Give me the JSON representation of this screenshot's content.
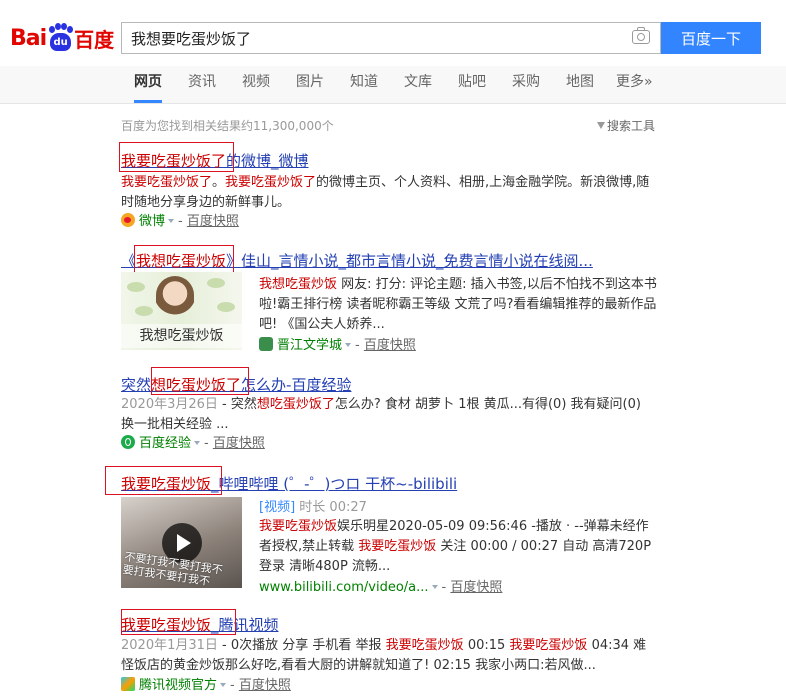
{
  "logo": {
    "bai": "Bai",
    "du": "du",
    "cn": "百度"
  },
  "search": {
    "query": "我想要吃蛋炒饭了",
    "button": "百度一下"
  },
  "tabs": [
    "网页",
    "资讯",
    "视频",
    "图片",
    "知道",
    "文库",
    "贴吧",
    "采购",
    "地图",
    "更多»"
  ],
  "active_tab": "网页",
  "result_count": "百度为您找到相关结果约11,300,000个",
  "search_tools": "搜索工具",
  "results": [
    {
      "title_hl": "我要吃蛋炒饭了",
      "title_rest": "的微博_微博",
      "desc_hl1": "我要吃蛋炒饭了",
      "desc_mid1": "。",
      "desc_hl2": "我要吃蛋炒饭了",
      "desc_rest": "的微博主页、个人资料、相册,上海金融学院。新浪微博,随时随地分享身边的新鲜事儿。",
      "source": "微博",
      "snapshot": "百度快照"
    },
    {
      "title_pre": "《",
      "title_hl": "我想吃蛋炒饭",
      "title_rest": "》佳山_言情小说_都市言情小说_免费言情小说在线阅...",
      "thumb_caption": "我想吃蛋炒饭",
      "desc_hl": "我想吃蛋炒饭",
      "desc_rest": " 网友: 打分: 评论主题: 插入书签,以后不怕找不到这本书啦!霸王排行榜 读者昵称霸王等级 文荒了吗?看看编辑推荐的最新作品吧! 《国公夫人娇养...",
      "source": "晋江文学城",
      "snapshot": "百度快照"
    },
    {
      "title_pre": "突然",
      "title_hl": "想吃蛋炒饭了",
      "title_rest": "怎么办-百度经验",
      "date": "2020年3月26日",
      "desc_pre": " - 突然",
      "desc_hl": "想吃蛋炒饭了",
      "desc_rest": "怎么办? 食材 胡萝卜 1根 黄瓜...有得(0) 我有疑问(0) 换一批相关经验 ...",
      "source": "百度经验",
      "snapshot": "百度快照"
    },
    {
      "title_hl": "我要吃蛋炒饭",
      "title_rest": "_哔哩哔哩 (゜-゜)つロ 干杯~-bilibili",
      "thumb_overlay1": "不要打我不要打我不",
      "thumb_overlay2": "要打我不要打我不",
      "tag": "[视频]",
      "duration_label": "时长 00:27",
      "desc_hl1": "我要吃蛋炒饭",
      "desc_mid1": "娱乐明星2020-05-09 09:56:46 -播放 · --弹幕未经作者授权,禁止转载 ",
      "desc_hl2": "我要吃蛋炒饭",
      "desc_rest": " 关注 00:00 / 00:27 自动 高清720P登录 清晰480P 流畅...",
      "url": "www.bilibili.com/video/a...",
      "snapshot": "百度快照"
    },
    {
      "title_hl": "我要吃蛋炒饭",
      "title_rest": "_腾讯视频",
      "date": "2020年1月31日",
      "desc_pre": " - 0次播放 分享 手机看 举报 ",
      "desc_hl1": "我要吃蛋炒饭",
      "desc_mid": " 00:15 ",
      "desc_hl2": "我要吃蛋炒饭",
      "desc_rest": " 04:34 难怪饭店的黄金炒饭那么好吃,看看大厨的讲解就知道了! 02:15 我家小两口:若风做...",
      "source": "腾讯视频官方",
      "snapshot": "百度快照"
    }
  ]
}
